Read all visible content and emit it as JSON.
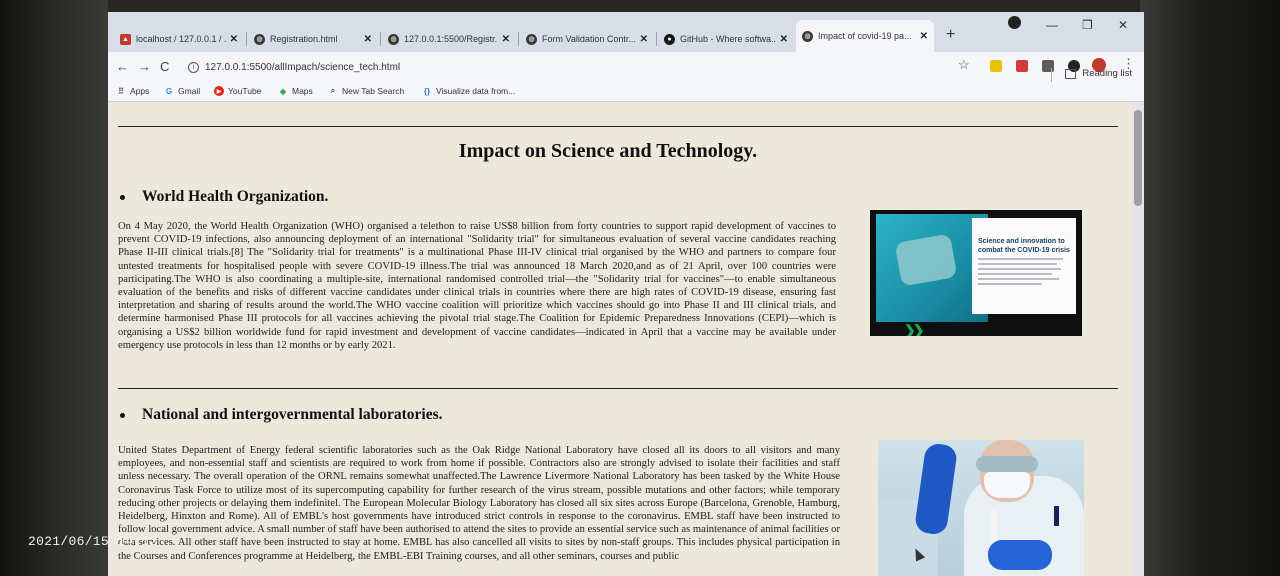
{
  "browser": {
    "tabs": [
      {
        "label": "localhost / 127.0.0.1 / ...",
        "favicon": "phpmyadmin-icon"
      },
      {
        "label": "Registration.html",
        "favicon": "globe-icon"
      },
      {
        "label": "127.0.0.1:5500/Registr...",
        "favicon": "globe-icon"
      },
      {
        "label": "Form Validation Contr...",
        "favicon": "globe-icon"
      },
      {
        "label": "GitHub - Where softwa...",
        "favicon": "github-icon"
      },
      {
        "label": "Impact of covid-19 pa...",
        "favicon": "globe-icon",
        "active": true
      }
    ],
    "new_tab": "+",
    "url": "127.0.0.1:5500/allImpach/science_tech.html",
    "reading_list": "Reading list",
    "bookmarks": [
      {
        "label": "Apps",
        "icon": "apps-grid-icon"
      },
      {
        "label": "Gmail",
        "icon": "google-icon"
      },
      {
        "label": "YouTube",
        "icon": "youtube-icon"
      },
      {
        "label": "Maps",
        "icon": "maps-icon"
      },
      {
        "label": "New Tab Search",
        "icon": "search-icon"
      },
      {
        "label": "Visualize data from...",
        "icon": "code-icon"
      }
    ]
  },
  "page": {
    "title": "Impact on Science and Technology.",
    "sections": [
      {
        "heading": "World Health Organization.",
        "text": "On 4 May 2020, the World Health Organization (WHO) organised a telethon to raise US$8 billion from forty countries to support rapid development of vaccines to prevent COVID-19 infections, also announcing deployment of an international \"Solidarity trial\" for simultaneous evaluation of several vaccine candidates reaching Phase II-III clinical trials.[8] The \"Solidarity trial for treatments\" is a multinational Phase III-IV clinical trial organised by the WHO and partners to compare four untested treatments for hospitalised people with severe COVID-19 illness.The trial was announced 18 March 2020,and as of 21 April, over 100 countries were participating.The WHO is also coordinating a multiple-site, international randomised controlled trial—the \"Solidarity trial for vaccines\"—to enable simultaneous evaluation of the benefits and risks of different vaccine candidates under clinical trials in countries where there are high rates of COVID-19 disease, ensuring fast interpretation and sharing of results around the world.The WHO vaccine coalition will prioritize which vaccines should go into Phase II and III clinical trials, and determine harmonised Phase III protocols for all vaccines achieving the pivotal trial stage.The Coalition for Epidemic Preparedness Innovations (CEPI)—which is organising a US$2 billion worldwide fund for rapid investment and development of vaccine candidates—indicated in April that a vaccine may be available under emergency use protocols in less than 12 months or by early 2021."
      },
      {
        "heading": "National and intergovernmental laboratories.",
        "text": "United States Department of Energy federal scientific laboratories such as the Oak Ridge National Laboratory have closed all its doors to all visitors and many employees, and non-essential staff and scientists are required to work from home if possible. Contractors also are strongly advised to isolate their facilities and staff unless necessary. The overall operation of the ORNL remains somewhat unaffected.The Lawrence Livermore National Laboratory has been tasked by the White House Coronavirus Task Force to utilize most of its supercomputing capability for further research of the virus stream, possible mutations and other factors; while temporary reducing other projects or delaying them indefinitel. The European Molecular Biology Laboratory has closed all six sites across Europe (Barcelona, Grenoble, Hamburg, Heidelberg, Hinxton and Rome). All of EMBL's host governments have introduced strict controls in response to the coronavirus. EMBL staff have been instructed to follow local government advice. A small number of staff have been authorised to attend the sites to provide an essential service such as maintenance of animal facilities or data services. All other staff have been instructed to stay at home. EMBL has also cancelled all visits to sites by non-staff groups. This includes physical participation in the Courses and Conferences programme at Heidelberg, the EMBL-EBI Training courses, and all other seminars, courses and public"
      }
    ],
    "who_image": {
      "title": "Science and innovation to combat the COVID-19 crisis"
    }
  },
  "overlay": {
    "timestamp": "2021/06/15 14:12"
  },
  "colors": {
    "page_bg": "#ece8dc",
    "tabstrip_bg": "#d8dee8",
    "toolbar_bg": "#f4f6f9"
  }
}
